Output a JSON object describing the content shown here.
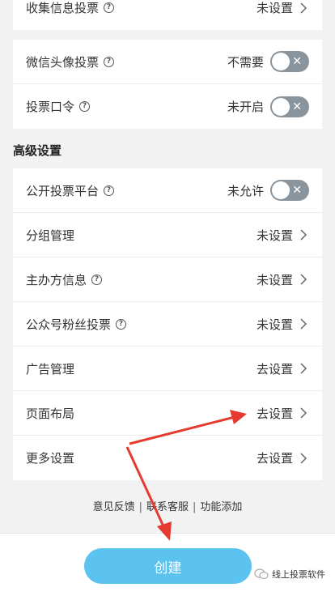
{
  "top_card": {
    "rows": [
      {
        "label": "收集信息投票",
        "value": "未设置",
        "help": "?"
      }
    ]
  },
  "vote_card": {
    "rows": [
      {
        "label": "微信头像投票",
        "value": "不需要",
        "help": "?",
        "toggle": "✕"
      },
      {
        "label": "投票口令",
        "value": "未开启",
        "help": "?",
        "toggle": "✕"
      }
    ]
  },
  "advanced": {
    "title": "高级设置",
    "rows": [
      {
        "label": "公开投票平台",
        "value": "未允许",
        "help": "?",
        "toggle": "✕"
      },
      {
        "label": "分组管理",
        "value": "未设置"
      },
      {
        "label": "主办方信息",
        "value": "未设置",
        "help": "?"
      },
      {
        "label": "公众号粉丝投票",
        "value": "未设置",
        "help": "?"
      },
      {
        "label": "广告管理",
        "value": "去设置"
      },
      {
        "label": "页面布局",
        "value": "去设置"
      },
      {
        "label": "更多设置",
        "value": "去设置"
      }
    ]
  },
  "footer": {
    "feedback": "意见反馈",
    "sep": "|",
    "contact": "联系客服",
    "features": "功能添加"
  },
  "bottom": {
    "create_label": "创建",
    "brand": "线上投票软件"
  },
  "colors": {
    "accent": "#5cc2f0",
    "toggle_off": "#8a949c",
    "annotation_arrow": "#e53a2f"
  }
}
